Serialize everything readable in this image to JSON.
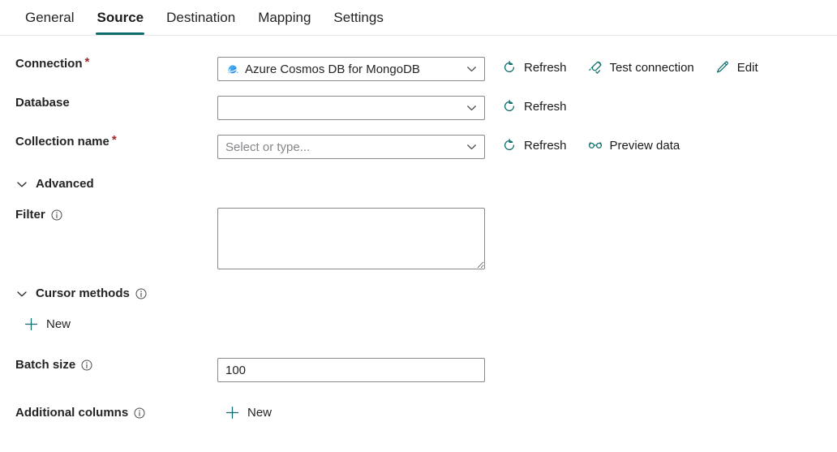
{
  "tabs": [
    {
      "label": "General",
      "active": false
    },
    {
      "label": "Source",
      "active": true
    },
    {
      "label": "Destination",
      "active": false
    },
    {
      "label": "Mapping",
      "active": false
    },
    {
      "label": "Settings",
      "active": false
    }
  ],
  "colors": {
    "accent_tab_underline": "#0f6c6c",
    "required_asterisk": "#a4262c",
    "command_icon": "#0f6c6c",
    "command_text": "#1b1a19",
    "field_border": "#8a8886",
    "placeholder_text": "#86868a",
    "label_text": "#242424",
    "cosmos_icon_blue": "#2d9cf5"
  },
  "form": {
    "connection": {
      "label": "Connection",
      "required": true,
      "required_marker": "*",
      "value": "Azure Cosmos DB for MongoDB",
      "icon": "azure-cosmos-db-icon",
      "commands": [
        {
          "label": "Refresh",
          "icon": "refresh-icon"
        },
        {
          "label": "Test connection",
          "icon": "plug-check-icon"
        },
        {
          "label": "Edit",
          "icon": "pencil-icon"
        }
      ]
    },
    "database": {
      "label": "Database",
      "required": false,
      "value": "",
      "placeholder": "",
      "commands": [
        {
          "label": "Refresh",
          "icon": "refresh-icon"
        }
      ]
    },
    "collection_name": {
      "label": "Collection name",
      "required": true,
      "required_marker": "*",
      "value": "",
      "placeholder": "Select or type...",
      "commands": [
        {
          "label": "Refresh",
          "icon": "refresh-icon"
        },
        {
          "label": "Preview data",
          "icon": "glasses-icon"
        }
      ]
    },
    "advanced_section": {
      "label": "Advanced",
      "expanded": true,
      "chevron": "chevron-down-icon"
    },
    "filter": {
      "label": "Filter",
      "info": true,
      "info_icon": "info-icon",
      "value": "",
      "placeholder": ""
    },
    "cursor_methods_section": {
      "label": "Cursor methods",
      "expanded": true,
      "chevron": "chevron-down-icon",
      "info": true,
      "info_icon": "info-icon",
      "new_button": {
        "label": "New",
        "icon": "plus-icon"
      }
    },
    "batch_size": {
      "label": "Batch size",
      "info": true,
      "info_icon": "info-icon",
      "value": "100"
    },
    "additional_columns": {
      "label": "Additional columns",
      "info": true,
      "info_icon": "info-icon",
      "new_button": {
        "label": "New",
        "icon": "plus-icon"
      }
    }
  }
}
